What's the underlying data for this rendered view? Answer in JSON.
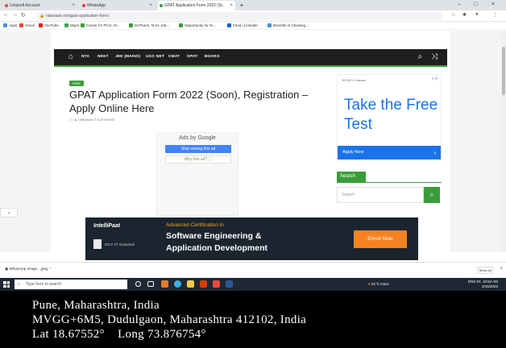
{
  "browser": {
    "tabs": [
      {
        "label": "Uniqsoft Account",
        "active": false
      },
      {
        "label": "WhatsApp",
        "active": false
      },
      {
        "label": "GPAT Application Form 2022 (Sc",
        "active": true
      }
    ],
    "new_tab": "+",
    "url": "nitawaan.net/gpat-application-form/",
    "bookmarks": [
      "Apps",
      "Gmail",
      "YouTube",
      "Maps",
      "Career for Ph.D, M...",
      "M.Pharm, M.Sc Job...",
      "Opportunity for M...",
      "Feed | LinkedIn",
      "Benefits of Chewing..."
    ]
  },
  "site": {
    "nav": [
      "NTA",
      "NEET",
      "JEE (MAINS)",
      "UGC NET",
      "CMAT",
      "GPAT",
      "BOOKS"
    ],
    "badge": "GPAT",
    "title": "GPAT Application Form 2022 (Soon), Registration – Apply Online Here",
    "meta": "nitawaan   0 Comments"
  },
  "google_ad": {
    "ads_by": "Ads by Google",
    "stop": "Stop seeing this ad",
    "why": "Why this ad? ⓘ"
  },
  "side_ad": {
    "advertiser": "BYJU'S Classes",
    "headline": "Take the Free Test",
    "cta": "Apply Now"
  },
  "search_widget": {
    "label": "Search",
    "placeholder": "Search"
  },
  "banner": {
    "logo": "IntelliPaat",
    "sub": "EICT IIT Guwahati",
    "small": "Advanced Certification in",
    "line1": "Software Engineering &",
    "line2": "Application Development",
    "cta": "Enroll Now"
  },
  "download_bar": {
    "item": "WhatsApp Image....jpeg",
    "show_all": "Show all"
  },
  "taskbar": {
    "search_placeholder": "Type here to search",
    "weather": "21°C Haze",
    "time": "10:52 AM",
    "date": "2/15/2022",
    "lang": "ENG IN"
  },
  "geotag": {
    "line1": "Pune, Maharashtra, India",
    "line2": "MVGG+6M5, Dudulgaon, Maharashtra 412102, India",
    "line3": "Lat 18.67552°    Long 73.876754°"
  },
  "colors": {
    "accent_green": "#3a9d3a",
    "ad_blue": "#1a73e8",
    "banner_orange": "#f5821f",
    "taskbar": "#1e2733"
  }
}
